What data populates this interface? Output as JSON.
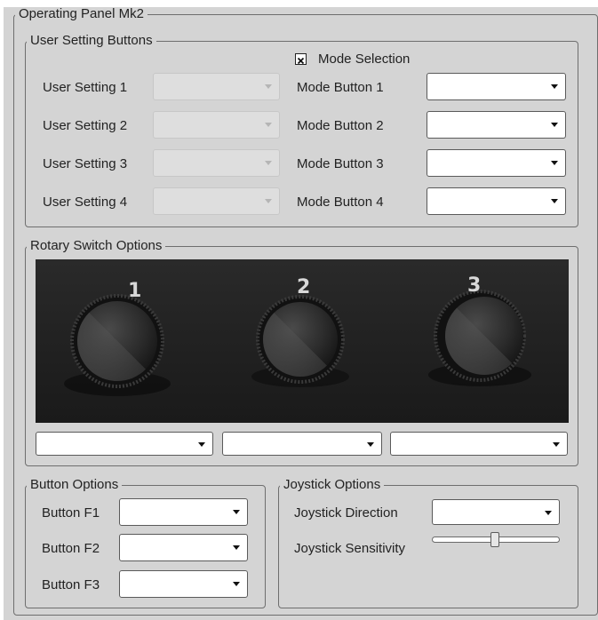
{
  "panel": {
    "title": "Operating Panel Mk2"
  },
  "user_settings": {
    "title": "User Setting Buttons",
    "mode_selection": {
      "label": "Mode Selection",
      "checked": true
    },
    "rows": [
      {
        "label": "User Setting 1",
        "mode_label": "Mode Button 1"
      },
      {
        "label": "User Setting 2",
        "mode_label": "Mode Button 2"
      },
      {
        "label": "User Setting 3",
        "mode_label": "Mode Button 3"
      },
      {
        "label": "User Setting 4",
        "mode_label": "Mode Button 4"
      }
    ]
  },
  "rotary": {
    "title": "Rotary Switch Options",
    "knobs": [
      {
        "number": "1"
      },
      {
        "number": "2"
      },
      {
        "number": "3"
      }
    ]
  },
  "button_options": {
    "title": "Button Options",
    "rows": [
      {
        "label": "Button F1"
      },
      {
        "label": "Button F2"
      },
      {
        "label": "Button F3"
      }
    ]
  },
  "joystick": {
    "title": "Joystick Options",
    "direction_label": "Joystick Direction",
    "sensitivity_label": "Joystick Sensitivity",
    "sensitivity_fraction": 0.49
  }
}
